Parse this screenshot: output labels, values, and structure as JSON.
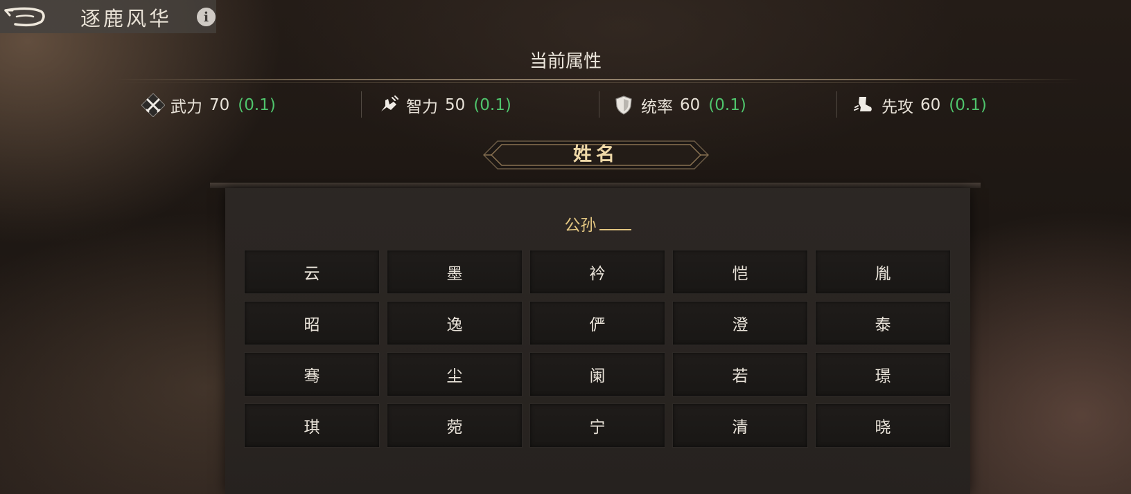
{
  "header": {
    "title": "逐鹿风华",
    "info_label": "i",
    "back_icon": "back-arrow-icon",
    "info_icon": "info-icon"
  },
  "attributes": {
    "heading": "当前属性",
    "stats": [
      {
        "icon": "crossed-swords-icon",
        "label": "武力",
        "value": "70",
        "delta": "(0.1)"
      },
      {
        "icon": "hand-intellect-icon",
        "label": "智力",
        "value": "50",
        "delta": "(0.1)"
      },
      {
        "icon": "shield-icon",
        "label": "统率",
        "value": "60",
        "delta": "(0.1)"
      },
      {
        "icon": "boot-icon",
        "label": "先攻",
        "value": "60",
        "delta": "(0.1)"
      }
    ]
  },
  "name_panel": {
    "title": "姓名",
    "surname": "公孙",
    "options": [
      "云",
      "墨",
      "衿",
      "恺",
      "胤",
      "昭",
      "逸",
      "俨",
      "澄",
      "泰",
      "骞",
      "尘",
      "阑",
      "若",
      "璟",
      "琪",
      "菀",
      "宁",
      "清",
      "晓"
    ]
  },
  "colors": {
    "delta_green": "#4fc46c",
    "gold": "#e3c681",
    "text": "#e8e2d8"
  }
}
